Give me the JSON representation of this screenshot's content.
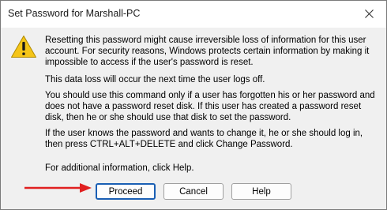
{
  "window": {
    "title": "Set Password for Marshall-PC"
  },
  "message": {
    "p1": "Resetting this password might cause irreversible loss of information for this user account. For security reasons, Windows protects certain information by making it impossible to access if the user's password is reset.",
    "p2": "This data loss will occur the next time the user logs off.",
    "p3": "You should use this command only if a user has forgotten his or her password and does not have a password reset disk. If this user has created a password reset disk, then he or she should use that disk to set the password.",
    "p4": "If the user knows the password and wants to change it, he or she should log in, then press CTRL+ALT+DELETE and click Change Password.",
    "p5": "For additional information, click Help."
  },
  "buttons": {
    "proceed": "Proceed",
    "cancel": "Cancel",
    "help": "Help"
  },
  "icons": {
    "warning": "warning-icon",
    "close": "close-icon",
    "annotation": "arrow-annotation"
  },
  "colors": {
    "accent": "#1a5fb4",
    "arrow": "#e02020",
    "warning": "#f5c518"
  }
}
